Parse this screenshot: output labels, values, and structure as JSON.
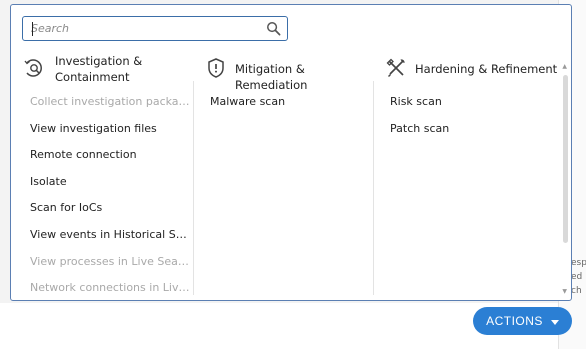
{
  "search": {
    "placeholder": "Search"
  },
  "columns": [
    {
      "title": "Investigation & Containment",
      "icon": "investigation-icon",
      "items": [
        {
          "label": "Collect investigation package",
          "disabled": true
        },
        {
          "label": "View investigation files",
          "disabled": false
        },
        {
          "label": "Remote connection",
          "disabled": false
        },
        {
          "label": "Isolate",
          "disabled": false
        },
        {
          "label": "Scan for IoCs",
          "disabled": false
        },
        {
          "label": "View events in Historical Search",
          "disabled": false
        },
        {
          "label": "View processes in Live Search",
          "disabled": true
        },
        {
          "label": "Network connections in Live Search",
          "disabled": true
        }
      ]
    },
    {
      "title": "Mitigation & Remediation",
      "icon": "shield-alert-icon",
      "items": [
        {
          "label": "Malware scan",
          "disabled": false
        }
      ]
    },
    {
      "title": "Hardening & Refinement",
      "icon": "tools-icon",
      "items": [
        {
          "label": "Risk scan",
          "disabled": false
        },
        {
          "label": "Patch scan",
          "disabled": false
        }
      ]
    }
  ],
  "background": {
    "fragments": [
      "esp",
      "ed",
      "ch"
    ]
  },
  "actions_button": {
    "label": "ACTIONS"
  },
  "colors": {
    "accent": "#2b7fd4",
    "border": "#5b7fb3",
    "disabled_text": "#a9a9a9"
  }
}
